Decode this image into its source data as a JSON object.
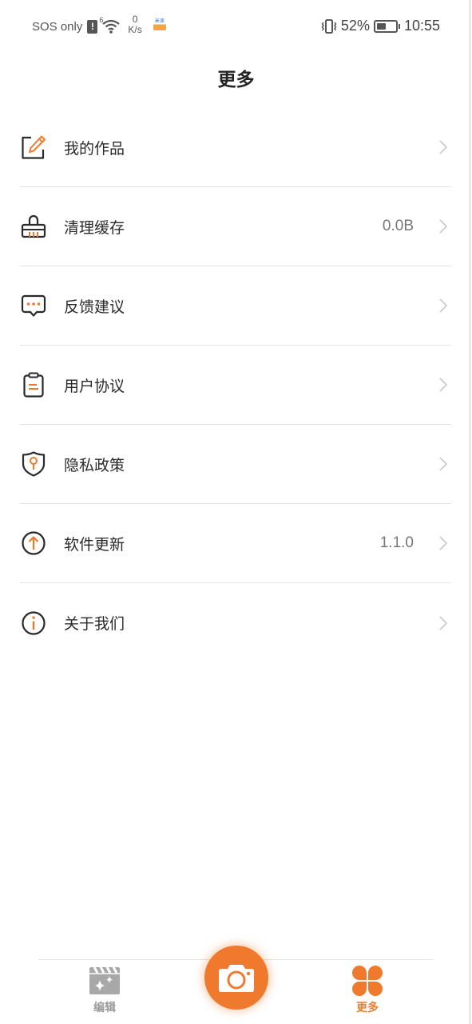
{
  "status_bar": {
    "carrier": "SOS only",
    "alert_glyph": "!",
    "network_gen": "6",
    "speed_value": "0",
    "speed_unit": "K/s",
    "app_badge": "米读",
    "battery_percent": "52%",
    "battery_level": 0.52,
    "time": "10:55"
  },
  "header": {
    "title": "更多"
  },
  "menu": {
    "items": [
      {
        "id": "my-works",
        "label": "我的作品",
        "value": "",
        "icon": "edit-pencil-icon"
      },
      {
        "id": "clear-cache",
        "label": "清理缓存",
        "value": "0.0B",
        "icon": "brush-icon"
      },
      {
        "id": "feedback",
        "label": "反馈建议",
        "value": "",
        "icon": "chat-bubble-icon"
      },
      {
        "id": "user-agreement",
        "label": "用户协议",
        "value": "",
        "icon": "clipboard-icon"
      },
      {
        "id": "privacy-policy",
        "label": "隐私政策",
        "value": "",
        "icon": "shield-key-icon"
      },
      {
        "id": "software-update",
        "label": "软件更新",
        "value": "1.1.0",
        "icon": "arrow-up-circle-icon"
      },
      {
        "id": "about-us",
        "label": "关于我们",
        "value": "",
        "icon": "info-circle-icon"
      }
    ]
  },
  "bottom_nav": {
    "tabs": [
      {
        "id": "edit",
        "label": "编辑",
        "icon": "clapperboard-sparkle-icon",
        "active": false
      },
      {
        "id": "camera",
        "label": "",
        "icon": "camera-icon",
        "active": false
      },
      {
        "id": "more",
        "label": "更多",
        "icon": "clover-icon",
        "active": true
      }
    ]
  },
  "colors": {
    "accent": "#ef7a2d",
    "icon_stroke": "#2a2a2a",
    "inactive": "#9a9a9a",
    "divider": "#e2e2e2",
    "value_text": "#777777"
  }
}
